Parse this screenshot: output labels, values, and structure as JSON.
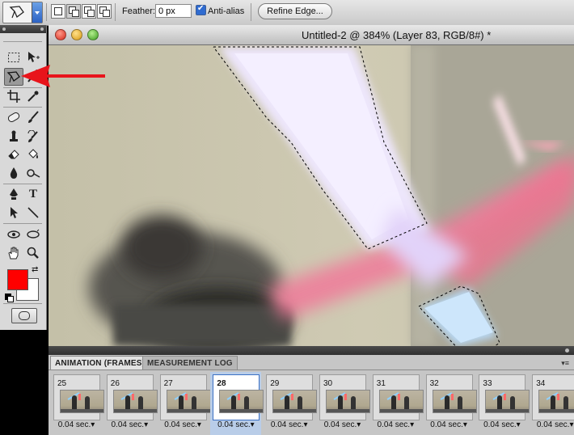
{
  "options_bar": {
    "feather_label": "Feather:",
    "feather_value": "0 px",
    "antialias_label": "Anti-alias",
    "antialias_checked": true,
    "refine_edge_label": "Refine Edge..."
  },
  "document": {
    "title": "Untitled-2 @ 384% (Layer 83, RGB/8#) *",
    "zoom_percent": 384
  },
  "tools_panel": {
    "active_tool": "polygonal-lasso",
    "foreground_color": "#ff0000",
    "background_color": "#ffffff"
  },
  "annotation": {
    "arrow_color": "#e8141b"
  },
  "animation_panel": {
    "tabs": [
      {
        "label": "ANIMATION (FRAMES)",
        "active": true
      },
      {
        "label": "MEASUREMENT LOG",
        "active": false
      }
    ],
    "frames": [
      {
        "number": "25",
        "delay": "0.04 sec."
      },
      {
        "number": "26",
        "delay": "0.04 sec."
      },
      {
        "number": "27",
        "delay": "0.04 sec."
      },
      {
        "number": "28",
        "delay": "0.04 sec.",
        "selected": true
      },
      {
        "number": "29",
        "delay": "0.04 sec."
      },
      {
        "number": "30",
        "delay": "0.04 sec."
      },
      {
        "number": "31",
        "delay": "0.04 sec."
      },
      {
        "number": "32",
        "delay": "0.04 sec."
      },
      {
        "number": "33",
        "delay": "0.04 sec."
      },
      {
        "number": "34",
        "delay": "0.04 sec."
      }
    ]
  }
}
